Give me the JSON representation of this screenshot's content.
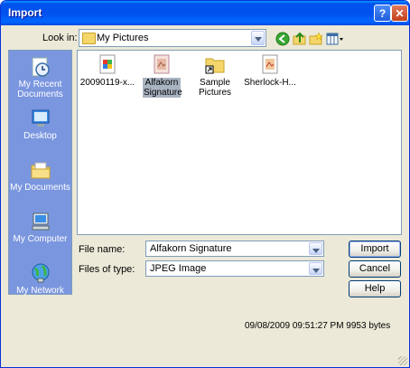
{
  "window": {
    "title": "Import",
    "help_glyph": "?",
    "close_glyph": "✕"
  },
  "toolbar": {
    "look_in_label": "Look in:",
    "look_in_value": "My Pictures",
    "icons": [
      "back-icon",
      "up-folder-icon",
      "new-folder-icon",
      "view-menu-icon"
    ]
  },
  "places": [
    {
      "label": "My Recent Documents",
      "icon": "recent-documents-icon"
    },
    {
      "label": "Desktop",
      "icon": "desktop-icon"
    },
    {
      "label": "My Documents",
      "icon": "my-documents-icon"
    },
    {
      "label": "My Computer",
      "icon": "my-computer-icon"
    },
    {
      "label": "My Network",
      "icon": "my-network-icon"
    }
  ],
  "files": [
    {
      "name": "20090119-x...",
      "icon": "image-file-icon",
      "selected": false
    },
    {
      "name": "Alfakorn Signature",
      "icon": "image-file-icon",
      "selected": true
    },
    {
      "name": "Sample Pictures",
      "icon": "folder-shortcut-icon",
      "selected": false
    },
    {
      "name": "Sherlock-H...",
      "icon": "image-file-icon",
      "selected": false
    }
  ],
  "filename": {
    "label": "File name:",
    "value": "Alfakorn Signature"
  },
  "filetype": {
    "label": "Files of type:",
    "value": "JPEG Image"
  },
  "buttons": {
    "import": "Import",
    "cancel": "Cancel",
    "help": "Help"
  },
  "status": "09/08/2009 09:51:27 PM 9953 bytes",
  "colors": {
    "title_bar": "#0054e3",
    "places_bar": "#7a96df",
    "dialog_bg": "#ece9d8",
    "selection": "#a9b4c2"
  }
}
